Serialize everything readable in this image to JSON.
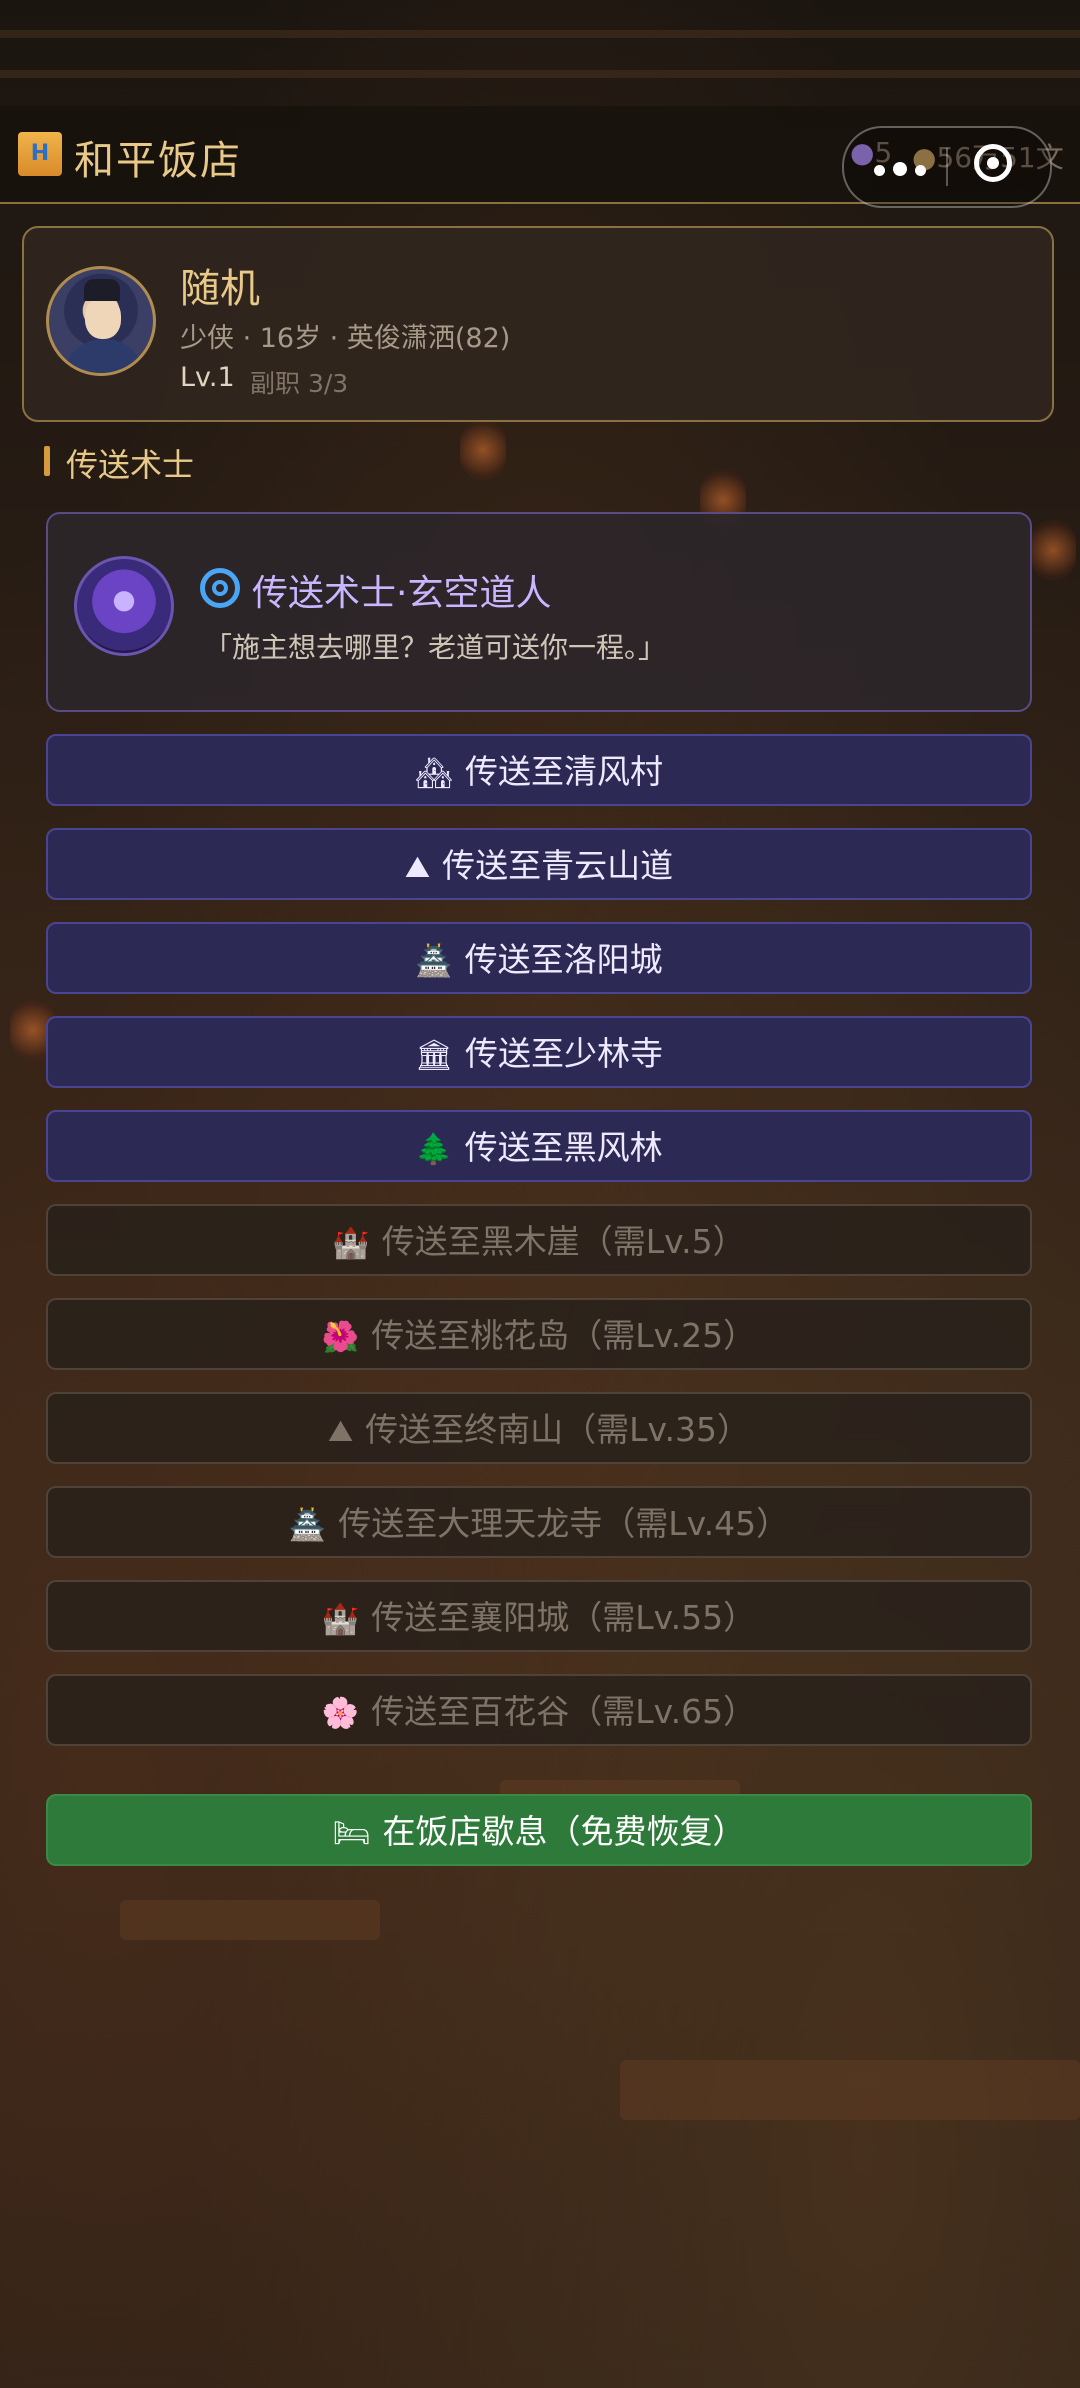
{
  "header": {
    "title_icon": "H",
    "title": "和平饭店",
    "resources": [
      {
        "icon": "gem-icon",
        "value": "5"
      },
      {
        "icon": "money-bag-icon",
        "value": "56万51文"
      }
    ]
  },
  "profile": {
    "name": "随机",
    "meta": "少侠 · 16岁 · 英俊潇洒(82)",
    "level": "Lv.1",
    "sub_jobs": "副职 3/3"
  },
  "section": {
    "title": "传送术士"
  },
  "npc": {
    "name": "传送术士·玄空道人",
    "quote": "「施主想去哪里？老道可送你一程。」"
  },
  "teleports": [
    {
      "icon": "🏘",
      "label": "传送至清风村",
      "locked": false
    },
    {
      "icon": "⛰",
      "label": "传送至青云山道",
      "locked": false
    },
    {
      "icon": "🏯",
      "label": "传送至洛阳城",
      "locked": false
    },
    {
      "icon": "🏛",
      "label": "传送至少林寺",
      "locked": false
    },
    {
      "icon": "🌲",
      "label": "传送至黑风林",
      "locked": false
    },
    {
      "icon": "🏰",
      "label": "传送至黑木崖（需Lv.5）",
      "locked": true
    },
    {
      "icon": "🌺",
      "label": "传送至桃花岛（需Lv.25）",
      "locked": true
    },
    {
      "icon": "⛰",
      "label": "传送至终南山（需Lv.35）",
      "locked": true
    },
    {
      "icon": "🏯",
      "label": "传送至大理天龙寺（需Lv.45）",
      "locked": true
    },
    {
      "icon": "🏰",
      "label": "传送至襄阳城（需Lv.55）",
      "locked": true
    },
    {
      "icon": "🌸",
      "label": "传送至百花谷（需Lv.65）",
      "locked": true
    }
  ],
  "rest_button": {
    "icon": "🛏",
    "label": "在饭店歇息（免费恢复）"
  }
}
